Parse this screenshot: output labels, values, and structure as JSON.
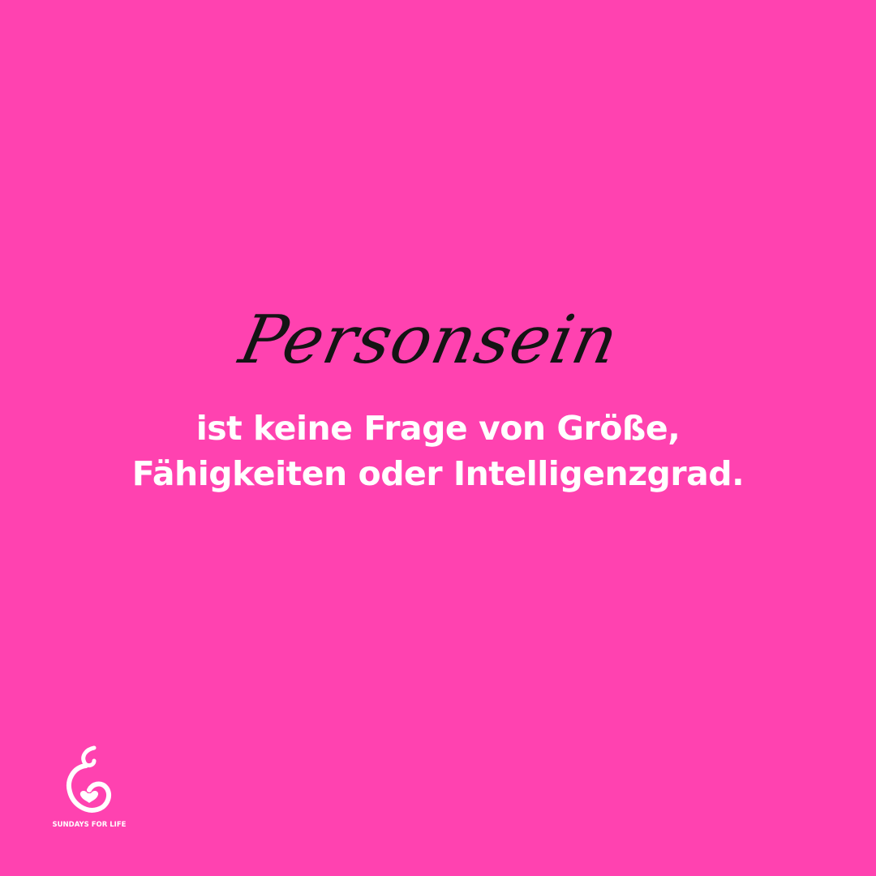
{
  "background_color": "#ff42b0",
  "script_color": "#141414",
  "text_color": "#ffffff",
  "script_word": "Personsein",
  "headline": {
    "line1": "ist keine Frage von Größe,",
    "line2": "Fähigkeiten oder Intelligenzgrad."
  },
  "logo": {
    "icon": "fetus-heart-icon",
    "name": "SUNDAYS FOR LIFE"
  }
}
